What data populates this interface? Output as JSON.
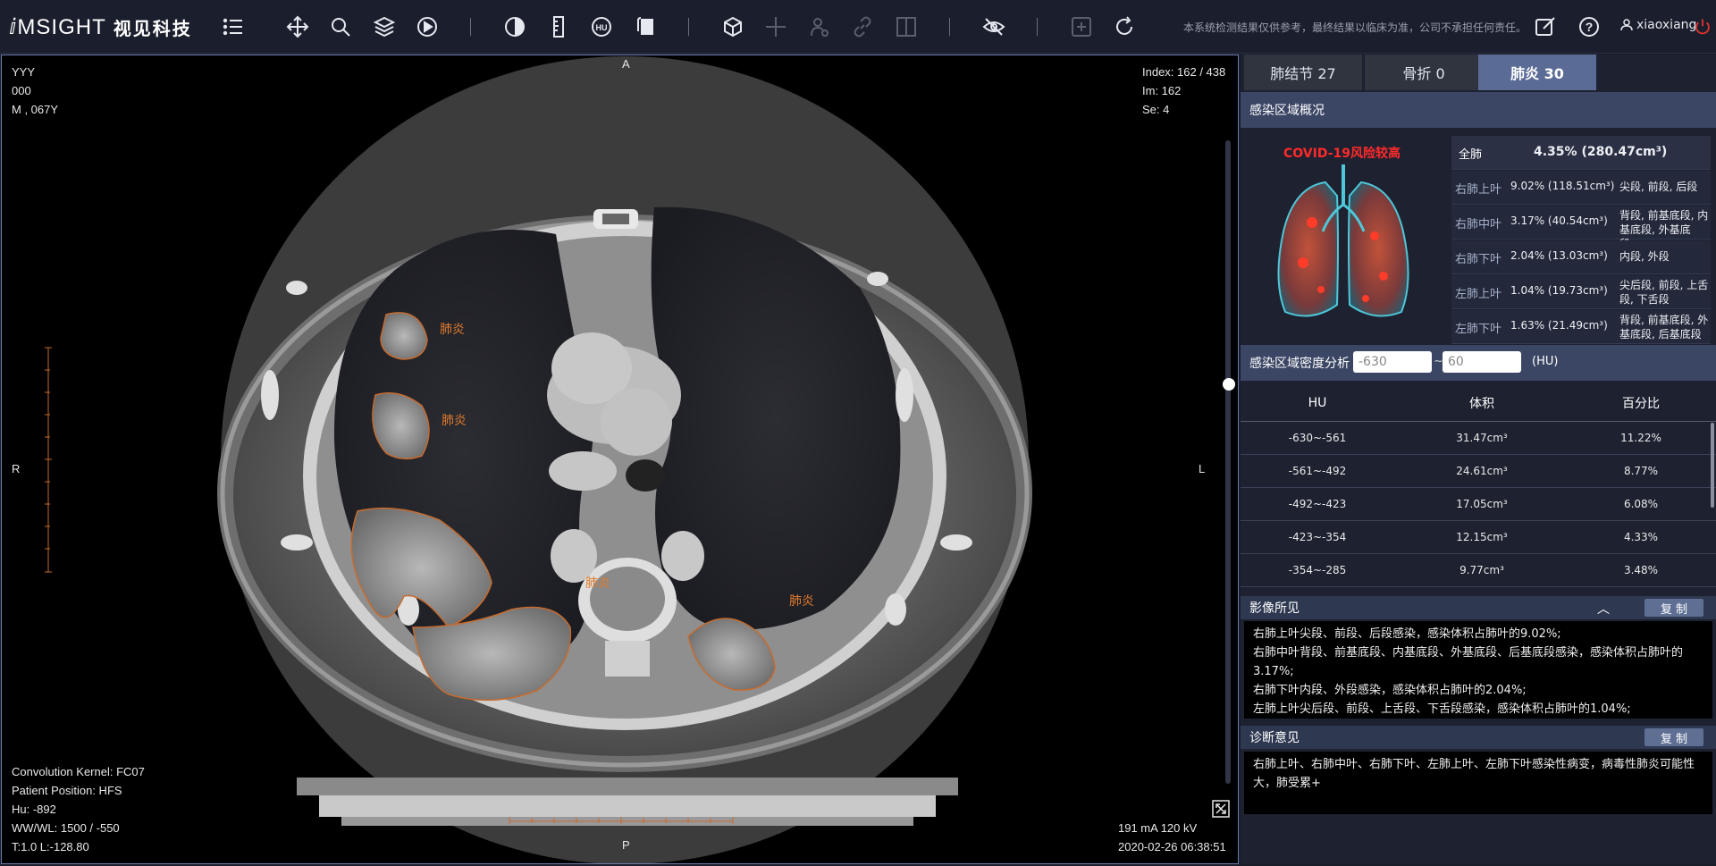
{
  "app": {
    "logo_text": "ⅈMSIGHT",
    "logo_cn": "视见科技",
    "disclaimer": "本系统检测结果仅供参考，最终结果以临床为准，公司不承担任何责任。",
    "username": "xiaoxiang"
  },
  "toolbar": {
    "icons": [
      "menu-list-icon",
      "move-icon",
      "zoom-icon",
      "layers-icon",
      "play-icon",
      "contrast-icon",
      "ruler-icon",
      "hu-icon",
      "rotate-icon",
      "cube-icon",
      "crosshair-icon",
      "person-icon",
      "link-icon",
      "split-view-icon",
      "hide-icon",
      "add-icon",
      "refresh-icon",
      "edit-icon",
      "help-icon",
      "user-icon",
      "power-icon"
    ]
  },
  "viewer": {
    "patient": [
      "YYY",
      "000",
      "M , 067Y"
    ],
    "index": [
      "Index: 162 / 438",
      "Im: 162",
      "Se: 4"
    ],
    "bottom_left": [
      "Convolution Kernel: FC07",
      "Patient Position: HFS",
      "Hu: -892",
      "WW/WL: 1500 / -550",
      "T:1.0 L:-128.80"
    ],
    "bottom_right": [
      "191 mA 120 kV",
      "2020-02-26 06:38:51"
    ],
    "orient": {
      "top": "A",
      "bottom": "P",
      "left": "R",
      "right": "L"
    },
    "annotation_label": "肺炎"
  },
  "tabs": [
    {
      "label": "肺结节 27",
      "active": false
    },
    {
      "label": "骨折 0",
      "active": false
    },
    {
      "label": "肺炎 30",
      "active": true
    }
  ],
  "overview": {
    "title": "感染区域概况",
    "risk": "COVID-19风险较高",
    "total_label": "全肺",
    "total_value": "4.35% (280.47cm³)",
    "rows": [
      {
        "lobe": "右肺上叶",
        "value": "9.02% (118.51cm³)",
        "segments": "尖段, 前段, 后段"
      },
      {
        "lobe": "右肺中叶",
        "value": "3.17% (40.54cm³)",
        "segments": "背段, 前基底段, 内基底段, 外基底段..."
      },
      {
        "lobe": "右肺下叶",
        "value": "2.04% (13.03cm³)",
        "segments": "内段, 外段"
      },
      {
        "lobe": "左肺上叶",
        "value": "1.04% (19.73cm³)",
        "segments": "尖后段, 前段, 上舌段, 下舌段"
      },
      {
        "lobe": "左肺下叶",
        "value": "1.63% (21.49cm³)",
        "segments": "背段, 前基底段, 外基底段, 后基底段"
      }
    ]
  },
  "density": {
    "title": "感染区域密度分析",
    "min": "-630",
    "max": "60",
    "tilde": "~",
    "unit": "(HU)",
    "headers": [
      "HU",
      "体积",
      "百分比"
    ],
    "rows": [
      [
        "-630~-561",
        "31.47cm³",
        "11.22%"
      ],
      [
        "-561~-492",
        "24.61cm³",
        "8.77%"
      ],
      [
        "-492~-423",
        "17.05cm³",
        "6.08%"
      ],
      [
        "-423~-354",
        "12.15cm³",
        "4.33%"
      ],
      [
        "-354~-285",
        "9.77cm³",
        "3.48%"
      ]
    ]
  },
  "findings": {
    "title": "影像所见",
    "copy": "复 制",
    "lines": [
      "右肺上叶尖段、前段、后段感染，感染体积占肺叶的9.02%;",
      "右肺中叶背段、前基底段、内基底段、外基底段、后基底段感染，感染体积占肺叶的3.17%;",
      "右肺下叶内段、外段感染，感染体积占肺叶的2.04%;",
      "左肺上叶尖后段、前段、上舌段、下舌段感染，感染体积占肺叶的1.04%;"
    ]
  },
  "diagnosis": {
    "title": "诊断意见",
    "copy": "复 制",
    "text": "右肺上叶、右肺中叶、右肺下叶、左肺上叶、左肺下叶感染性病变，病毒性肺炎可能性大，肺受累+"
  }
}
